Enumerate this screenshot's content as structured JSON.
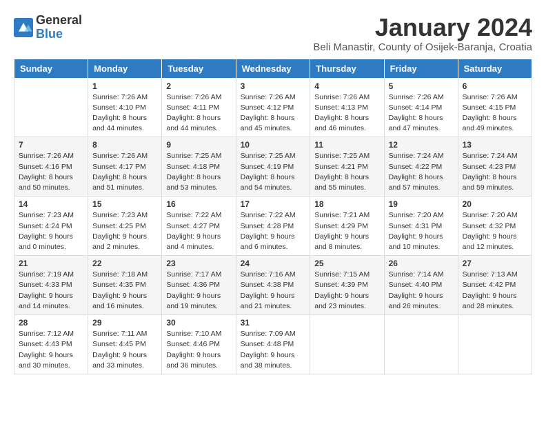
{
  "header": {
    "logo_general": "General",
    "logo_blue": "Blue",
    "title": "January 2024",
    "location": "Beli Manastir, County of Osijek-Baranja, Croatia"
  },
  "days_of_week": [
    "Sunday",
    "Monday",
    "Tuesday",
    "Wednesday",
    "Thursday",
    "Friday",
    "Saturday"
  ],
  "weeks": [
    [
      {
        "day": "",
        "info": ""
      },
      {
        "day": "1",
        "info": "Sunrise: 7:26 AM\nSunset: 4:10 PM\nDaylight: 8 hours\nand 44 minutes."
      },
      {
        "day": "2",
        "info": "Sunrise: 7:26 AM\nSunset: 4:11 PM\nDaylight: 8 hours\nand 44 minutes."
      },
      {
        "day": "3",
        "info": "Sunrise: 7:26 AM\nSunset: 4:12 PM\nDaylight: 8 hours\nand 45 minutes."
      },
      {
        "day": "4",
        "info": "Sunrise: 7:26 AM\nSunset: 4:13 PM\nDaylight: 8 hours\nand 46 minutes."
      },
      {
        "day": "5",
        "info": "Sunrise: 7:26 AM\nSunset: 4:14 PM\nDaylight: 8 hours\nand 47 minutes."
      },
      {
        "day": "6",
        "info": "Sunrise: 7:26 AM\nSunset: 4:15 PM\nDaylight: 8 hours\nand 49 minutes."
      }
    ],
    [
      {
        "day": "7",
        "info": "Sunrise: 7:26 AM\nSunset: 4:16 PM\nDaylight: 8 hours\nand 50 minutes."
      },
      {
        "day": "8",
        "info": "Sunrise: 7:26 AM\nSunset: 4:17 PM\nDaylight: 8 hours\nand 51 minutes."
      },
      {
        "day": "9",
        "info": "Sunrise: 7:25 AM\nSunset: 4:18 PM\nDaylight: 8 hours\nand 53 minutes."
      },
      {
        "day": "10",
        "info": "Sunrise: 7:25 AM\nSunset: 4:19 PM\nDaylight: 8 hours\nand 54 minutes."
      },
      {
        "day": "11",
        "info": "Sunrise: 7:25 AM\nSunset: 4:21 PM\nDaylight: 8 hours\nand 55 minutes."
      },
      {
        "day": "12",
        "info": "Sunrise: 7:24 AM\nSunset: 4:22 PM\nDaylight: 8 hours\nand 57 minutes."
      },
      {
        "day": "13",
        "info": "Sunrise: 7:24 AM\nSunset: 4:23 PM\nDaylight: 8 hours\nand 59 minutes."
      }
    ],
    [
      {
        "day": "14",
        "info": "Sunrise: 7:23 AM\nSunset: 4:24 PM\nDaylight: 9 hours\nand 0 minutes."
      },
      {
        "day": "15",
        "info": "Sunrise: 7:23 AM\nSunset: 4:25 PM\nDaylight: 9 hours\nand 2 minutes."
      },
      {
        "day": "16",
        "info": "Sunrise: 7:22 AM\nSunset: 4:27 PM\nDaylight: 9 hours\nand 4 minutes."
      },
      {
        "day": "17",
        "info": "Sunrise: 7:22 AM\nSunset: 4:28 PM\nDaylight: 9 hours\nand 6 minutes."
      },
      {
        "day": "18",
        "info": "Sunrise: 7:21 AM\nSunset: 4:29 PM\nDaylight: 9 hours\nand 8 minutes."
      },
      {
        "day": "19",
        "info": "Sunrise: 7:20 AM\nSunset: 4:31 PM\nDaylight: 9 hours\nand 10 minutes."
      },
      {
        "day": "20",
        "info": "Sunrise: 7:20 AM\nSunset: 4:32 PM\nDaylight: 9 hours\nand 12 minutes."
      }
    ],
    [
      {
        "day": "21",
        "info": "Sunrise: 7:19 AM\nSunset: 4:33 PM\nDaylight: 9 hours\nand 14 minutes."
      },
      {
        "day": "22",
        "info": "Sunrise: 7:18 AM\nSunset: 4:35 PM\nDaylight: 9 hours\nand 16 minutes."
      },
      {
        "day": "23",
        "info": "Sunrise: 7:17 AM\nSunset: 4:36 PM\nDaylight: 9 hours\nand 19 minutes."
      },
      {
        "day": "24",
        "info": "Sunrise: 7:16 AM\nSunset: 4:38 PM\nDaylight: 9 hours\nand 21 minutes."
      },
      {
        "day": "25",
        "info": "Sunrise: 7:15 AM\nSunset: 4:39 PM\nDaylight: 9 hours\nand 23 minutes."
      },
      {
        "day": "26",
        "info": "Sunrise: 7:14 AM\nSunset: 4:40 PM\nDaylight: 9 hours\nand 26 minutes."
      },
      {
        "day": "27",
        "info": "Sunrise: 7:13 AM\nSunset: 4:42 PM\nDaylight: 9 hours\nand 28 minutes."
      }
    ],
    [
      {
        "day": "28",
        "info": "Sunrise: 7:12 AM\nSunset: 4:43 PM\nDaylight: 9 hours\nand 30 minutes."
      },
      {
        "day": "29",
        "info": "Sunrise: 7:11 AM\nSunset: 4:45 PM\nDaylight: 9 hours\nand 33 minutes."
      },
      {
        "day": "30",
        "info": "Sunrise: 7:10 AM\nSunset: 4:46 PM\nDaylight: 9 hours\nand 36 minutes."
      },
      {
        "day": "31",
        "info": "Sunrise: 7:09 AM\nSunset: 4:48 PM\nDaylight: 9 hours\nand 38 minutes."
      },
      {
        "day": "",
        "info": ""
      },
      {
        "day": "",
        "info": ""
      },
      {
        "day": "",
        "info": ""
      }
    ]
  ]
}
